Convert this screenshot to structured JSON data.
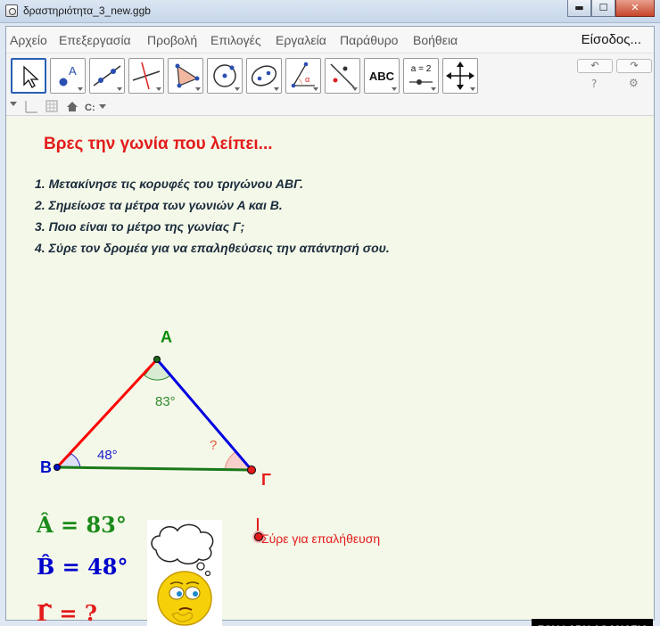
{
  "window": {
    "title": "δραστηριότητα_3_new.ggb",
    "minimize": "▬",
    "maximize": "☐",
    "close": "✕"
  },
  "menu": {
    "items": [
      "Αρχείο",
      "Επεξεργασία",
      "Προβολή",
      "Επιλογές",
      "Εργαλεία",
      "Παράθυρο",
      "Βοήθεια"
    ],
    "sign_in": "Είσοδος..."
  },
  "toolbar": {
    "tools": [
      {
        "name": "move-tool-icon"
      },
      {
        "name": "point-tool-icon"
      },
      {
        "name": "line-tool-icon"
      },
      {
        "name": "perpendicular-tool-icon"
      },
      {
        "name": "polygon-tool-icon"
      },
      {
        "name": "circle-tool-icon"
      },
      {
        "name": "ellipse-tool-icon"
      },
      {
        "name": "angle-tool-icon"
      },
      {
        "name": "reflect-tool-icon"
      },
      {
        "name": "text-tool-icon",
        "label": "ABC"
      },
      {
        "name": "slider-tool-icon",
        "label": "a = 2"
      },
      {
        "name": "move-graphics-view-icon"
      }
    ],
    "undo": "↶",
    "redo": "↷",
    "help": "?",
    "settings": "⚙"
  },
  "canvas": {
    "heading": "Βρες την γωνία που λείπει...",
    "steps": [
      "1. Μετακίνησε τις κορυφές του τριγώνου ΑΒΓ.",
      "2.  Σημείωσε τα μέτρα των γωνιών Α και Β.",
      "3.  Ποιο είναι το μέτρο της γωνίας Γ;",
      "4.  Σύρε τον δρομέα για να επαληθεύσεις την απάντησή σου."
    ],
    "vertices": {
      "A": "Α",
      "B": "Β",
      "C": "Γ"
    },
    "angle_labels": {
      "A": "83°",
      "B": "48°",
      "C": "?"
    },
    "equations": {
      "A": "Â = 83°",
      "B": "B̂ = 48°",
      "C": "Γ̂ = ?"
    },
    "slider_label": "Σύρε για επαλήθευση",
    "author": "ΣΟΥΦΑΡΗ ΑΘΑΝΑΣΙΑ",
    "colors": {
      "heading": "#e31b1b",
      "side_ab": "#ff0000",
      "side_ag": "#0000e0",
      "side_bg": "#1a7a1a",
      "vertex_a": "#0a8a0a",
      "vertex_b": "#0010c8",
      "vertex_g": "#e31b1b",
      "background": "#f4f8e8"
    }
  }
}
